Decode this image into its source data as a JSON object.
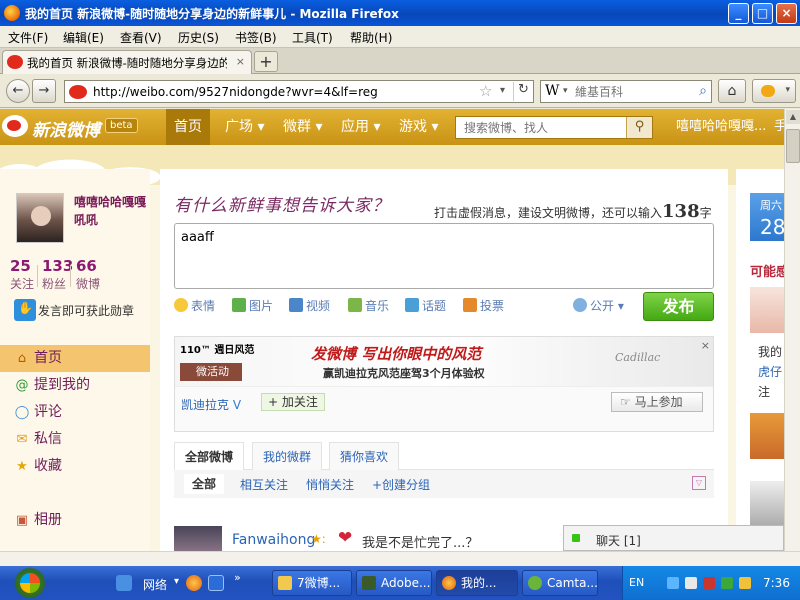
{
  "window": {
    "title": "我的首页 新浪微博-随时随地分享身边的新鲜事儿 - Mozilla Firefox",
    "controls": [
      "_",
      "□",
      "×"
    ]
  },
  "menu": [
    "文件(F)",
    "编辑(E)",
    "查看(V)",
    "历史(S)",
    "书签(B)",
    "工具(T)",
    "帮助(H)"
  ],
  "tab": {
    "title": "我的首页 新浪微博-随时随地分享身边的...",
    "close": "×",
    "new_tab": "+"
  },
  "nav": {
    "url": "http://weibo.com/9527nidongde?wvr=4&lf=reg",
    "search_placeholder": "維基百科",
    "search_engine": "W"
  },
  "weibo": {
    "brand": "新浪微博",
    "beta": "beta",
    "nav": [
      "首页",
      "广场 ▾",
      "微群 ▾",
      "应用 ▾",
      "游戏 ▾"
    ],
    "search_placeholder": "搜索微博、找人",
    "username_top": "嘻嘻哈哈嘎嘎...",
    "more": "手"
  },
  "profile": {
    "name": "嘻嘻哈哈嘎嘎吼吼",
    "stats": [
      {
        "value": "25",
        "label": "关注"
      },
      {
        "value": "133",
        "label": "粉丝"
      },
      {
        "value": "66",
        "label": "微博"
      }
    ],
    "medal_text": "发言即可获此勋章"
  },
  "sidebar_nav": [
    {
      "label": "首页",
      "icon": "home-icon"
    },
    {
      "label": "提到我的",
      "icon": "at-icon"
    },
    {
      "label": "评论",
      "icon": "comment-icon"
    },
    {
      "label": "私信",
      "icon": "mail-icon"
    },
    {
      "label": "收藏",
      "icon": "star-icon"
    },
    {
      "label": "相册",
      "icon": "album-icon"
    }
  ],
  "compose": {
    "title": "有什么新鲜事想告诉大家？",
    "hint": "打击虚假消息，建设文明微博，还可以输入",
    "count": "138",
    "unit": "字",
    "text": "aaaff",
    "tools": [
      "表情",
      "图片",
      "视频",
      "音乐",
      "话题",
      "投票"
    ],
    "visibility": "公开 ▾",
    "publish": "发布"
  },
  "ad": {
    "weekly": "110™ 週日风范",
    "headline": "发微博  写出你眼中的风范",
    "sub": "赢凯迪拉克风范座驾3个月体验权",
    "tag": "微活动",
    "brand": "Cadillac",
    "account": "凯迪拉克",
    "follow": "+ 加关注",
    "join": "马上参加",
    "close": "×"
  },
  "feed_tabs": [
    "全部微博",
    "我的微群",
    "猜你喜欢"
  ],
  "sub_tabs": [
    "全部",
    "相互关注",
    "悄悄关注",
    "+创建分组"
  ],
  "post": {
    "author": "Fanwaihong",
    "text": "我是不是忙完了...？"
  },
  "right": {
    "day": "周六",
    "date": "28",
    "heading": "可能感",
    "line1": "我的",
    "line2": "虎仔",
    "line3": "注"
  },
  "chat": {
    "label": "聊天 [1]"
  },
  "taskbar": {
    "network": "网络",
    "tasks": [
      "7微博...",
      "Adobe...",
      "我的...",
      "Camta..."
    ],
    "lang": "EN",
    "time": "7:36"
  },
  "colors": {
    "weibo_gold": "#d6a21f",
    "publish_green": "#52b61c",
    "link_blue": "#2a64b5",
    "xp_blue": "#245edb"
  }
}
